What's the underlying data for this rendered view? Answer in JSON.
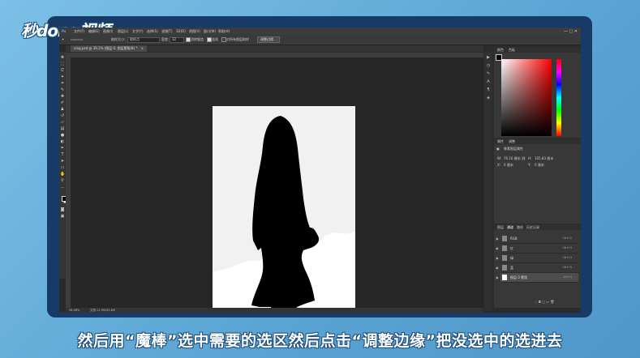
{
  "watermark": {
    "logo_text": "秒dong视频"
  },
  "app": {
    "menu": [
      "文件(F)",
      "编辑(E)",
      "图像(I)",
      "图层(L)",
      "文字(Y)",
      "选择(S)",
      "滤镜(T)",
      "3D(D)",
      "视图(V)",
      "窗口(W)",
      "帮助(H)"
    ],
    "window_controls": "— ▢ ✕"
  },
  "options": {
    "sample_size_label": "取样大小:",
    "sample_size_value": "取样点",
    "tolerance_label": "容差:",
    "tolerance_value": "32",
    "anti_alias": "消除锯齿",
    "contiguous": "连续",
    "sample_all_layers": "对所有图层取样",
    "refine_edge_button": "调整边缘..."
  },
  "document": {
    "tab_title": "ning.psd @ 39.1% (图层 0, 图层蒙版/8) *",
    "tab_close": "×"
  },
  "status": {
    "zoom": "36.06%",
    "doc_info": "文档:11.9M/45.8M"
  },
  "panels": {
    "color_tabs": [
      "颜色",
      "色板"
    ],
    "properties_tabs": [
      "属性",
      "调整"
    ],
    "properties_title": "像素图层属性",
    "properties_rows": [
      {
        "k": "W:",
        "v": "76.16 厘米"
      },
      {
        "k": "H:",
        "v": "105.83 厘米"
      },
      {
        "k": "X:",
        "v": "0 厘米"
      },
      {
        "k": "Y:",
        "v": "0 厘米"
      }
    ],
    "layers_tabs": [
      "图层",
      "通道",
      "路径",
      "历史记录"
    ],
    "channels": [
      {
        "name": "RGB",
        "shortcut": "Ctrl+2"
      },
      {
        "name": "红",
        "shortcut": "Ctrl+3"
      },
      {
        "name": "绿",
        "shortcut": "Ctrl+4"
      },
      {
        "name": "蓝",
        "shortcut": "Ctrl+5"
      },
      {
        "name": "图层 0 蒙版",
        "shortcut": "Ctrl+\\"
      }
    ]
  },
  "caption": "然后用“魔棒”选中需要的选区然后点击“调整边缘”把没选中的选进去",
  "colors": {
    "frame": "#173a66",
    "app_bg": "#2b2b2b",
    "panel_bg": "#383838"
  }
}
